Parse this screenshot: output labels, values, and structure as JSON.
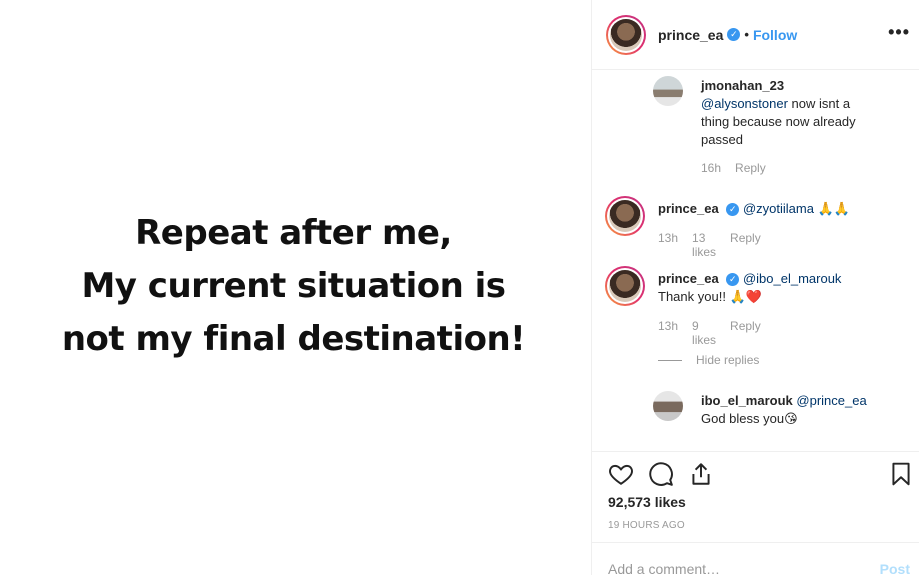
{
  "post": {
    "lines": [
      "Repeat after me,",
      "My current situation  is",
      "not my final destination!"
    ]
  },
  "header": {
    "username": "prince_ea",
    "separator": "•",
    "follow_label": "Follow",
    "more_label": "•••"
  },
  "comments": [
    {
      "user": "jmonahan_23",
      "mention": "@alysonstoner",
      "text": " now isnt a thing because now already passed",
      "time": "16h",
      "likes": "",
      "reply": "Reply"
    },
    {
      "user": "prince_ea",
      "mention": "@zyotiilama",
      "text": " 🙏🙏",
      "time": "13h",
      "likes": "13 likes",
      "reply": "Reply"
    },
    {
      "user": "prince_ea",
      "mention": "@ibo_el_marouk",
      "text": "Thank you!! 🙏❤️",
      "time": "13h",
      "likes": "9 likes",
      "reply": "Reply"
    },
    {
      "user": "ibo_el_marouk",
      "mention": "@prince_ea",
      "text": "God bless you😘"
    }
  ],
  "hide_replies": "Hide replies",
  "likes_count": "92,573 likes",
  "posted_ago": "19 HOURS AGO",
  "add_comment": {
    "placeholder": "Add a comment…",
    "post_label": "Post"
  },
  "colors": {
    "link": "#3897f0",
    "mention": "#003569",
    "muted": "#999999",
    "border": "#efefef"
  },
  "icons": [
    "heart-icon",
    "comment-icon",
    "share-icon",
    "bookmark-icon",
    "verified-icon",
    "more-icon"
  ]
}
